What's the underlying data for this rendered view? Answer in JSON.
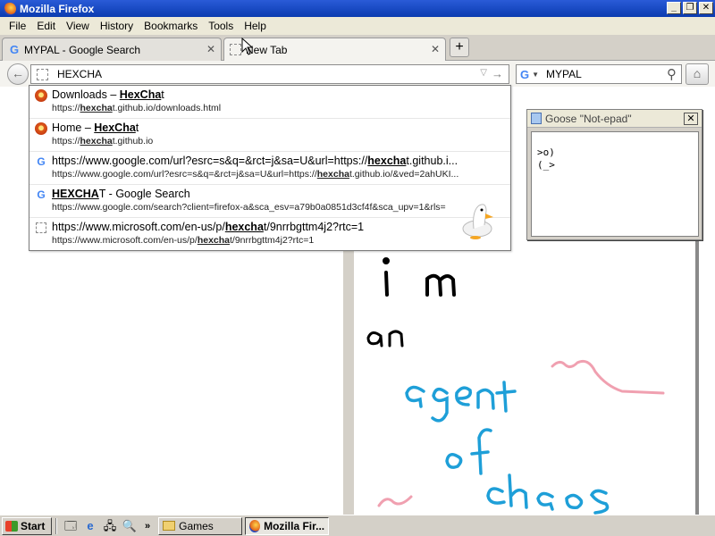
{
  "window": {
    "title": "Mozilla Firefox",
    "minimize": "_",
    "maximize": "❐",
    "close": "✕"
  },
  "menu": [
    "File",
    "Edit",
    "View",
    "History",
    "Bookmarks",
    "Tools",
    "Help"
  ],
  "tabs": [
    {
      "label": "MYPAL - Google Search",
      "close": "✕"
    },
    {
      "label": "New Tab",
      "close": "✕"
    }
  ],
  "new_tab_label": "+",
  "navbar": {
    "back": "←",
    "url_value": "HEXCHA",
    "url_dropdown": "▽",
    "url_go": "→",
    "search_engine_glyph": "G",
    "search_engine_arrow": "▼",
    "search_value": "MYPAL",
    "home": "⌂"
  },
  "autocomplete": [
    {
      "icon": "hexchat-icon",
      "title_parts": [
        "Downloads – ",
        "HexCha",
        "t"
      ],
      "url_parts": [
        "https://",
        "hexcha",
        "t.github.io/downloads.html"
      ]
    },
    {
      "icon": "hexchat-icon",
      "title_parts": [
        "Home – ",
        "HexCha",
        "t"
      ],
      "url_parts": [
        "https://",
        "hexcha",
        "t.github.io"
      ]
    },
    {
      "icon": "google-icon",
      "title_parts": [
        "https://www.google.com/url?esrc=s&q=&rct=j&sa=U&url=https://",
        "hexcha",
        "t.github.i..."
      ],
      "url_parts": [
        "https://www.google.com/url?esrc=s&q=&rct=j&sa=U&url=https://",
        "hexcha",
        "t.github.io/&ved=2ahUKI..."
      ]
    },
    {
      "icon": "google-icon",
      "title_parts": [
        "",
        "HEXCHA",
        "T - Google Search"
      ],
      "url_parts": [
        "https://www.google.com/search?client=firefox-a&sca_esv=a79b0a0851d3cf4f&sca_upv=1&rls=",
        "",
        ""
      ]
    },
    {
      "icon": "blank-page-icon",
      "title_parts": [
        "https://www.microsoft.com/en-us/p/",
        "hexcha",
        "t/9nrrbgttm4j2?rtc=1"
      ],
      "url_parts": [
        "https://www.microsoft.com/en-us/p/",
        "hexcha",
        "t/9nrrbgttm4j2?rtc=1"
      ]
    }
  ],
  "goose_window": {
    "title": "Goose \"Not-epad\"",
    "close": "✕",
    "text": ">o)\n(_>"
  },
  "drawing": {
    "words": [
      "i m",
      "an",
      "agent",
      "of",
      "chaos"
    ],
    "colors": {
      "black": "#000000",
      "blue": "#1e9fd8",
      "pink": "#f0a0b0"
    }
  },
  "taskbar": {
    "start": "Start",
    "quicklaunch_more": "»",
    "tasks": [
      {
        "label": "Games",
        "icon": "folder-icon"
      },
      {
        "label": "Mozilla Fir...",
        "icon": "firefox-icon"
      }
    ]
  }
}
